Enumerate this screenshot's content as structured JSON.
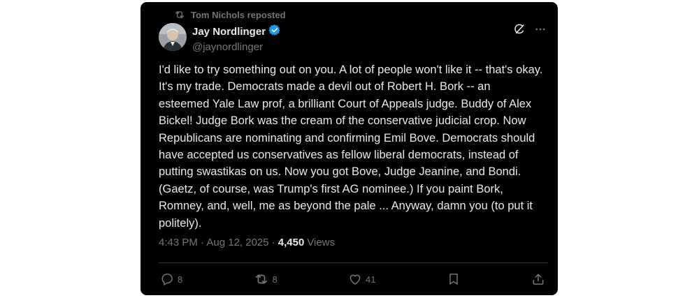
{
  "repost": {
    "icon": "repost-icon",
    "text": "Tom Nichols reposted"
  },
  "author": {
    "name": "Jay Nordlinger",
    "handle": "@jaynordlinger",
    "verified_icon": "verified-badge-icon",
    "verified_color": "#1d9bf0"
  },
  "header_actions": {
    "grok_icon": "grok-icon",
    "more_icon": "more-icon"
  },
  "tweet": {
    "text": "I'd like to try something out on you. A lot of people won't like it -- that's okay. It's my trade. Democrats made a devil out of Robert H. Bork -- an esteemed Yale Law prof, a brilliant Court of Appeals judge. Buddy of Alex Bickel! Judge Bork was the cream of the conservative judicial crop. Now Republicans are nominating and confirming Emil Bove. Democrats should have accepted us conservatives as fellow liberal democrats, instead of putting swastikas on us. Now you got Bove, Judge Jeanine, and Bondi. (Gaetz, of course, was Trump's first AG nominee.) If you paint Bork, Romney, and, well, me as beyond the pale ... Anyway, damn you (to put it politely)."
  },
  "meta": {
    "timestamp": "4:43 PM · Aug 12, 2025 ·",
    "views_count": "4,450",
    "views_label": "Views"
  },
  "actions": {
    "reply": {
      "icon": "reply-icon",
      "count": "8"
    },
    "repost": {
      "icon": "repost-icon",
      "count": "8"
    },
    "like": {
      "icon": "heart-icon",
      "count": "41"
    },
    "bookmark": {
      "icon": "bookmark-icon"
    },
    "share": {
      "icon": "share-icon"
    }
  },
  "colors": {
    "background": "#000000",
    "text": "#e7e9ea",
    "secondary": "#71767b",
    "border": "#2f3336"
  }
}
